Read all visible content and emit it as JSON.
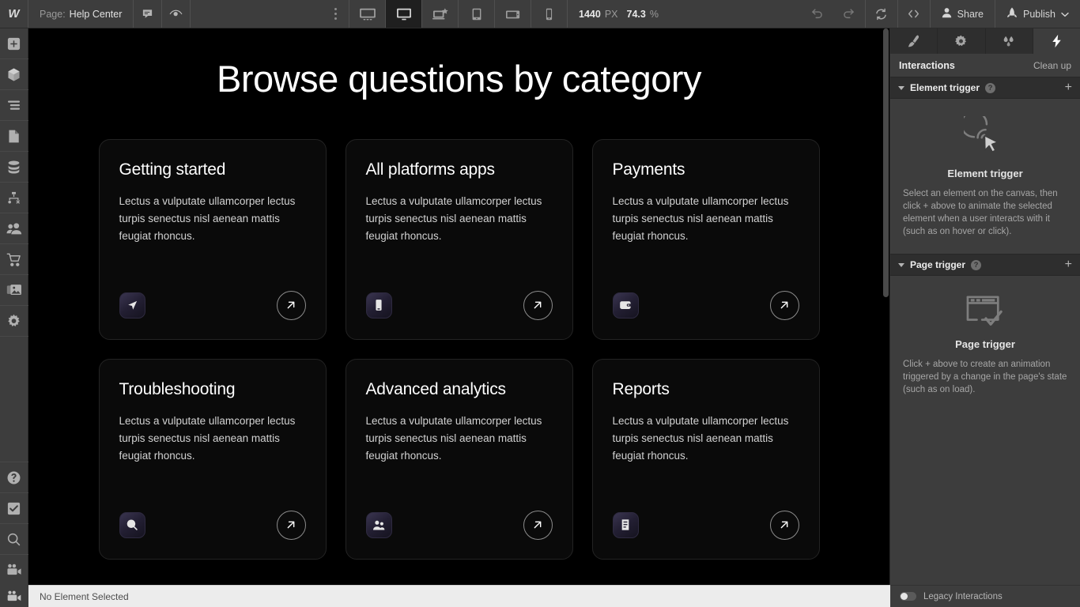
{
  "topbar": {
    "logo": "W",
    "page_label": "Page:",
    "page_name": "Help Center",
    "comment_icon": "comment-icon",
    "preview_icon": "eye-icon",
    "more_icon": "more-vertical-icon",
    "breakpoints": [
      {
        "name": "desktop-large",
        "icon": "monitor-wide-icon",
        "active": false
      },
      {
        "name": "desktop",
        "icon": "monitor-icon",
        "active": true
      },
      {
        "name": "tablet-landscape",
        "icon": "laptop-star-icon",
        "active": false
      },
      {
        "name": "tablet",
        "icon": "tablet-portrait-icon",
        "active": false
      },
      {
        "name": "mobile-landscape",
        "icon": "mobile-landscape-icon",
        "active": false
      },
      {
        "name": "mobile-portrait",
        "icon": "mobile-portrait-icon",
        "active": false
      }
    ],
    "canvas_width": "1440",
    "canvas_width_unit": "PX",
    "zoom_value": "74.3",
    "zoom_unit": "%",
    "undo_icon": "undo-icon",
    "redo_icon": "redo-icon",
    "refresh_icon": "refresh-icon",
    "code_icon": "code-brackets-icon",
    "share_label": "Share",
    "share_icon": "person-icon",
    "publish_label": "Publish",
    "publish_icon": "rocket-icon",
    "publish_caret": "chevron-down-icon"
  },
  "left_rail": {
    "items": [
      {
        "name": "add-elements",
        "icon": "plus-square-icon"
      },
      {
        "name": "components",
        "icon": "cube-icon"
      },
      {
        "name": "navigator",
        "icon": "layers-lines-icon"
      },
      {
        "name": "pages",
        "icon": "page-icon"
      },
      {
        "name": "cms",
        "icon": "database-icon"
      },
      {
        "name": "logic",
        "icon": "flow-node-icon"
      },
      {
        "name": "users",
        "icon": "people-icon"
      },
      {
        "name": "ecommerce",
        "icon": "cart-icon"
      },
      {
        "name": "assets",
        "icon": "images-icon"
      },
      {
        "name": "settings",
        "icon": "gear-icon"
      }
    ],
    "bottom_items": [
      {
        "name": "help",
        "icon": "question-circle-icon"
      },
      {
        "name": "audit",
        "icon": "checkbox-icon"
      },
      {
        "name": "search",
        "icon": "search-icon"
      },
      {
        "name": "video",
        "icon": "video-camera-icon"
      }
    ]
  },
  "canvas": {
    "heading": "Browse questions by category",
    "cards": [
      {
        "title": "Getting started",
        "description": "Lectus a vulputate ullamcorper lectus turpis senectus nisl aenean mattis feugiat rhoncus.",
        "icon": "navigation-arrow-icon",
        "arrow_icon": "arrow-up-right-icon"
      },
      {
        "title": "All platforms apps",
        "description": "Lectus a vulputate ullamcorper lectus turpis senectus nisl aenean mattis feugiat rhoncus.",
        "icon": "mobile-phone-icon",
        "arrow_icon": "arrow-up-right-icon"
      },
      {
        "title": "Payments",
        "description": "Lectus a vulputate ullamcorper lectus turpis senectus nisl aenean mattis feugiat rhoncus.",
        "icon": "wallet-icon",
        "arrow_icon": "arrow-up-right-icon"
      },
      {
        "title": "Troubleshooting",
        "description": "Lectus a vulputate ullamcorper lectus turpis senectus nisl aenean mattis feugiat rhoncus.",
        "icon": "magnifier-icon",
        "arrow_icon": "arrow-up-right-icon"
      },
      {
        "title": "Advanced analytics",
        "description": "Lectus a vulputate ullamcorper lectus turpis senectus nisl aenean mattis feugiat rhoncus.",
        "icon": "people-icon",
        "arrow_icon": "arrow-up-right-icon"
      },
      {
        "title": "Reports",
        "description": "Lectus a vulputate ullamcorper lectus turpis senectus nisl aenean mattis feugiat rhoncus.",
        "icon": "document-icon",
        "arrow_icon": "arrow-up-right-icon"
      }
    ]
  },
  "right_panel": {
    "tabs": [
      {
        "name": "style",
        "icon": "paintbrush-icon",
        "active": false
      },
      {
        "name": "settings",
        "icon": "gear-icon",
        "active": false
      },
      {
        "name": "style-manager",
        "icon": "droplets-icon",
        "active": false
      },
      {
        "name": "interactions",
        "icon": "lightning-bolt-icon",
        "active": true
      }
    ],
    "title": "Interactions",
    "action": "Clean up",
    "sections": [
      {
        "name": "element-trigger",
        "label": "Element trigger",
        "help": "?",
        "add": "+",
        "empty_icon": "cursor-click-icon",
        "empty_title": "Element trigger",
        "empty_text": "Select an element on the canvas, then click + above to animate the selected element when a user interacts with it (such as on hover or click)."
      },
      {
        "name": "page-trigger",
        "label": "Page trigger",
        "help": "?",
        "add": "+",
        "empty_icon": "browser-check-icon",
        "empty_title": "Page trigger",
        "empty_text": "Click + above to create an animation triggered by a change in the page's state (such as on load)."
      }
    ]
  },
  "statusbar": {
    "icon": "video-camera-icon",
    "selection_text": "No Element Selected",
    "legacy_label": "Legacy Interactions",
    "legacy_on": false
  },
  "colors": {
    "chrome": "#3d3d3d",
    "chrome_dark": "#2e2e2e",
    "canvas_bg": "#000000",
    "card_bg": "#0a0a0a",
    "card_border": "#232323",
    "status_bg": "#ececec"
  }
}
